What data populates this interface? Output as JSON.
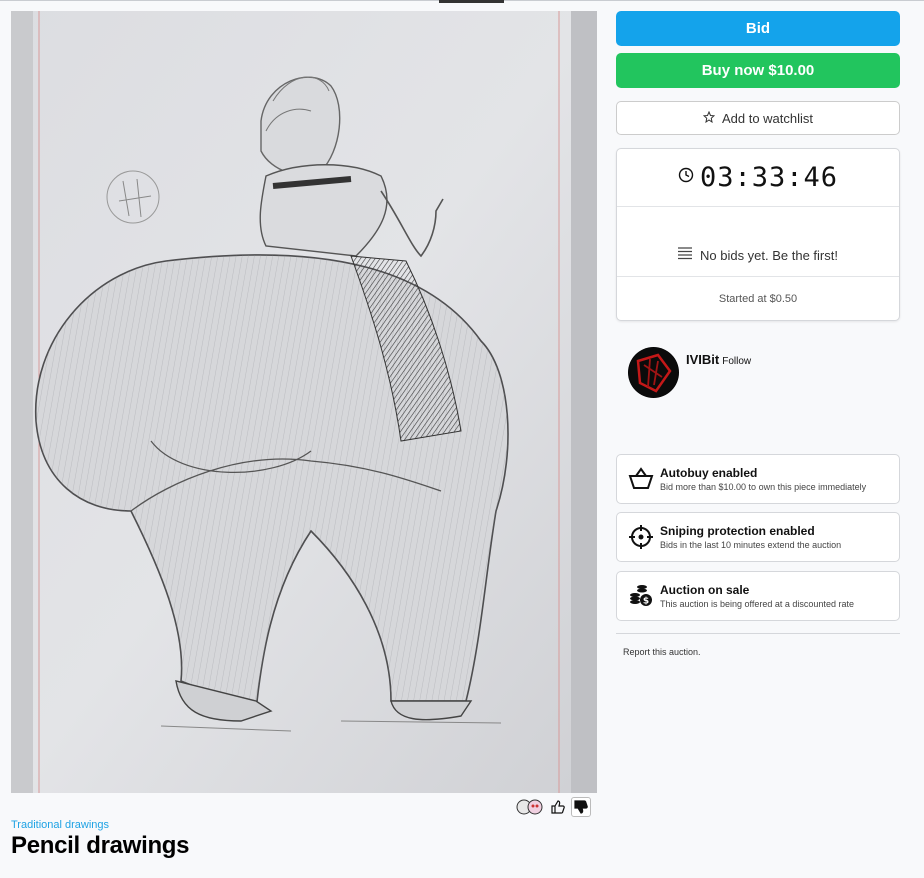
{
  "auction": {
    "bid_label": "Bid",
    "buy_now_label": "Buy now $10.00",
    "watchlist_label": "Add to watchlist",
    "timer": "03:33:46",
    "no_bids_text": "No bids yet. Be the first!",
    "started_text": "Started at $0.50"
  },
  "seller": {
    "name": "IVIBit",
    "follow_label": "Follow"
  },
  "features": [
    {
      "title": "Autobuy enabled",
      "desc": "Bid more than $10.00 to own this piece immediately",
      "icon": "basket-icon"
    },
    {
      "title": "Sniping protection enabled",
      "desc": "Bids in the last 10 minutes extend the auction",
      "icon": "crosshair-icon"
    },
    {
      "title": "Auction on sale",
      "desc": "This auction is being offered at a discounted rate",
      "icon": "coins-icon"
    }
  ],
  "report_label": "Report this auction.",
  "artwork": {
    "category": "Traditional drawings",
    "title": "Pencil drawings",
    "image": "pencil sketch artwork"
  },
  "reactions": {
    "emoji_icon": "reaction-emoji-icon",
    "like_icon": "thumbs-up-icon",
    "dislike_icon": "thumbs-down-icon"
  },
  "colors": {
    "bid": "#14a3eb",
    "buy_now": "#22c55e",
    "link": "#1ea2e4"
  }
}
